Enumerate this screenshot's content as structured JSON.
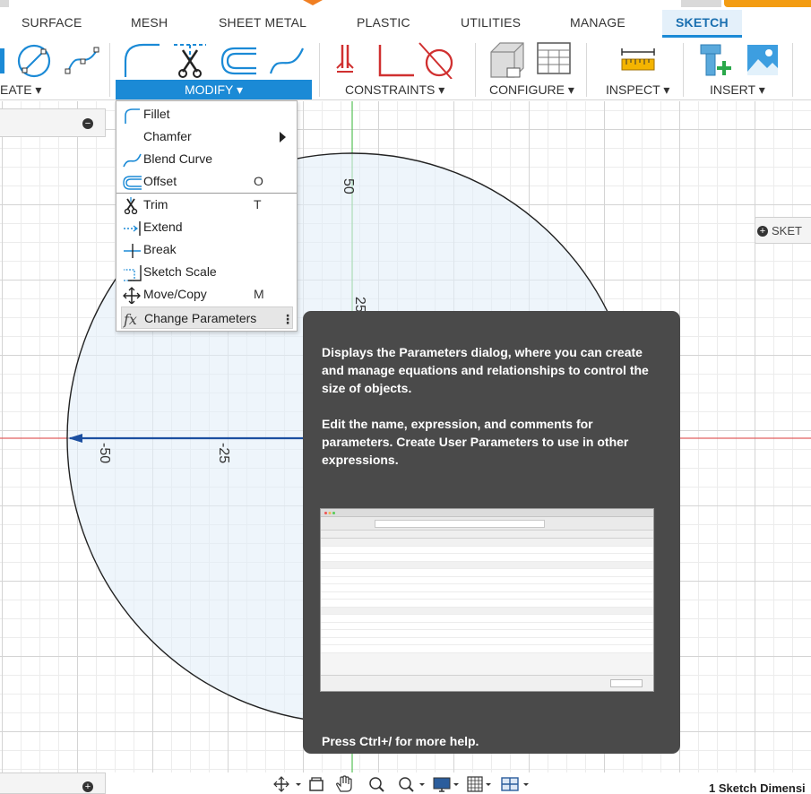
{
  "tabs": [
    {
      "label": "SURFACE"
    },
    {
      "label": "MESH"
    },
    {
      "label": "SHEET METAL"
    },
    {
      "label": "PLASTIC"
    },
    {
      "label": "UTILITIES"
    },
    {
      "label": "MANAGE"
    },
    {
      "label": "SKETCH",
      "active": true
    }
  ],
  "ribbon": {
    "groups": [
      {
        "label": "EATE ▾"
      },
      {
        "label": "MODIFY ▾",
        "selected": true
      },
      {
        "label": "CONSTRAINTS ▾"
      },
      {
        "label": "CONFIGURE ▾"
      },
      {
        "label": "INSPECT ▾"
      },
      {
        "label": "INSERT ▾"
      }
    ]
  },
  "modify_menu": {
    "items": [
      {
        "label": "Fillet",
        "key": "",
        "icon": "fillet-icon"
      },
      {
        "label": "Chamfer",
        "key": "",
        "icon": "chamfer-icon",
        "submenu": true
      },
      {
        "label": "Blend Curve",
        "key": "",
        "icon": "blend-curve-icon"
      },
      {
        "label": "Offset",
        "key": "O",
        "icon": "offset-icon"
      },
      {
        "label": "Trim",
        "key": "T",
        "icon": "scissors-icon"
      },
      {
        "label": "Extend",
        "key": "",
        "icon": "extend-icon"
      },
      {
        "label": "Break",
        "key": "",
        "icon": "break-icon"
      },
      {
        "label": "Sketch Scale",
        "key": "",
        "icon": "sketch-scale-icon"
      },
      {
        "label": "Move/Copy",
        "key": "M",
        "icon": "move-icon"
      },
      {
        "label": "Change Parameters",
        "key": "",
        "icon": "fx-icon",
        "highlighted": true
      }
    ],
    "more_options": "⋮"
  },
  "canvas": {
    "dimension_labels": [
      "50",
      "25",
      "-50",
      "-25"
    ],
    "sketch_pill_label": "SKET"
  },
  "tooltip": {
    "paragraph1": "Displays the Parameters dialog, where you can create and manage equations and relationships to control the size of objects.",
    "paragraph2": "Edit the name, expression, and comments for parameters. Create User Parameters to use in other expressions.",
    "help": "Press Ctrl+/ for more help."
  },
  "status": {
    "text": "1 Sketch Dimensi"
  },
  "colors": {
    "accent": "#1b8ad6",
    "tooltip_bg": "#4a4a4a",
    "sketch_line": "#1c4fa0",
    "axis_red": "#e06060",
    "axis_green": "#58c058"
  }
}
